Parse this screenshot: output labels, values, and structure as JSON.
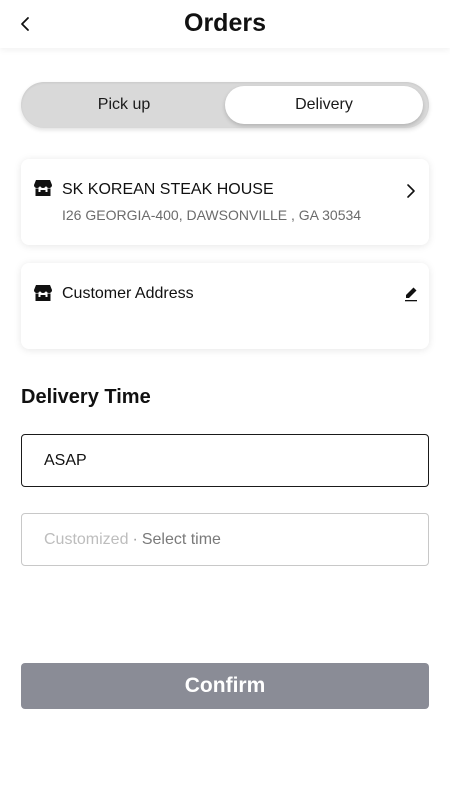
{
  "header": {
    "title": "Orders",
    "back_icon": "chevron-left-icon"
  },
  "mode_toggle": {
    "options": [
      "Pick up",
      "Delivery"
    ],
    "selected": "Delivery"
  },
  "restaurant": {
    "icon": "store-icon",
    "name": "SK KOREAN STEAK HOUSE",
    "address": "I26 GEORGIA-400, DAWSONVILLE , GA 30534",
    "action_icon": "chevron-right-icon"
  },
  "customer": {
    "icon": "store-icon",
    "label": "Customer Address",
    "action_icon": "pencil-icon"
  },
  "delivery_time": {
    "title": "Delivery Time",
    "asap_value": "ASAP",
    "custom_prefix": "Customized",
    "custom_separator": "·",
    "custom_action": "Select time"
  },
  "confirm": {
    "label": "Confirm"
  },
  "colors": {
    "confirm_bg": "#8a8c96",
    "segment_bg": "#d9d9d9",
    "text_primary": "#111111",
    "text_secondary": "#6b6b6b"
  }
}
